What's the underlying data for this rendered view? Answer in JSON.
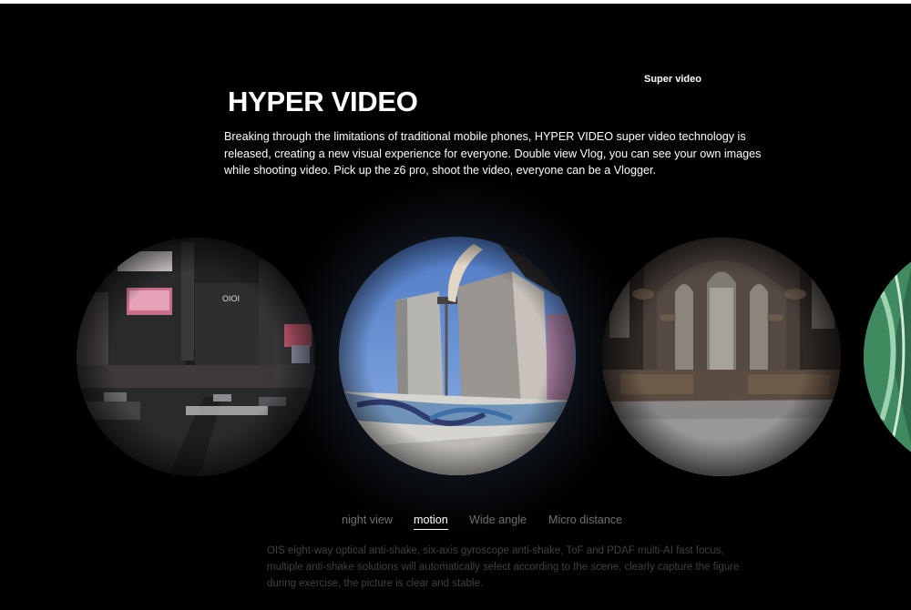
{
  "header": {
    "super_label": "Super video",
    "title": "HYPER VIDEO",
    "intro": "Breaking through the limitations of traditional mobile phones, HYPER VIDEO super video technology is released, creating a new visual experience for everyone. Double view Vlog, you can see your own images while shooting video. Pick up the z6 pro, shoot the video, everyone can be a Vlogger."
  },
  "gallery": {
    "images": [
      {
        "name": "city-night-street-image"
      },
      {
        "name": "skatepark-fisheye-image"
      },
      {
        "name": "cathedral-hall-image"
      },
      {
        "name": "partial-green-image"
      }
    ]
  },
  "tabs": {
    "active_index": 1,
    "items": [
      {
        "label": "night view"
      },
      {
        "label": "motion"
      },
      {
        "label": "Wide angle"
      },
      {
        "label": "Micro distance"
      }
    ]
  },
  "description": "OIS eight-way optical anti-shake, six-axis gyroscope anti-shake, ToF and PDAF multi-AI fast focus, multiple anti-shake solutions will automatically select according to the scene, clearly capture the figure during exercise, the picture is clear and stable.",
  "colors": {
    "background": "#000000",
    "text": "#ffffff",
    "tab_inactive": "#6f6f6f",
    "description": "#404040"
  }
}
